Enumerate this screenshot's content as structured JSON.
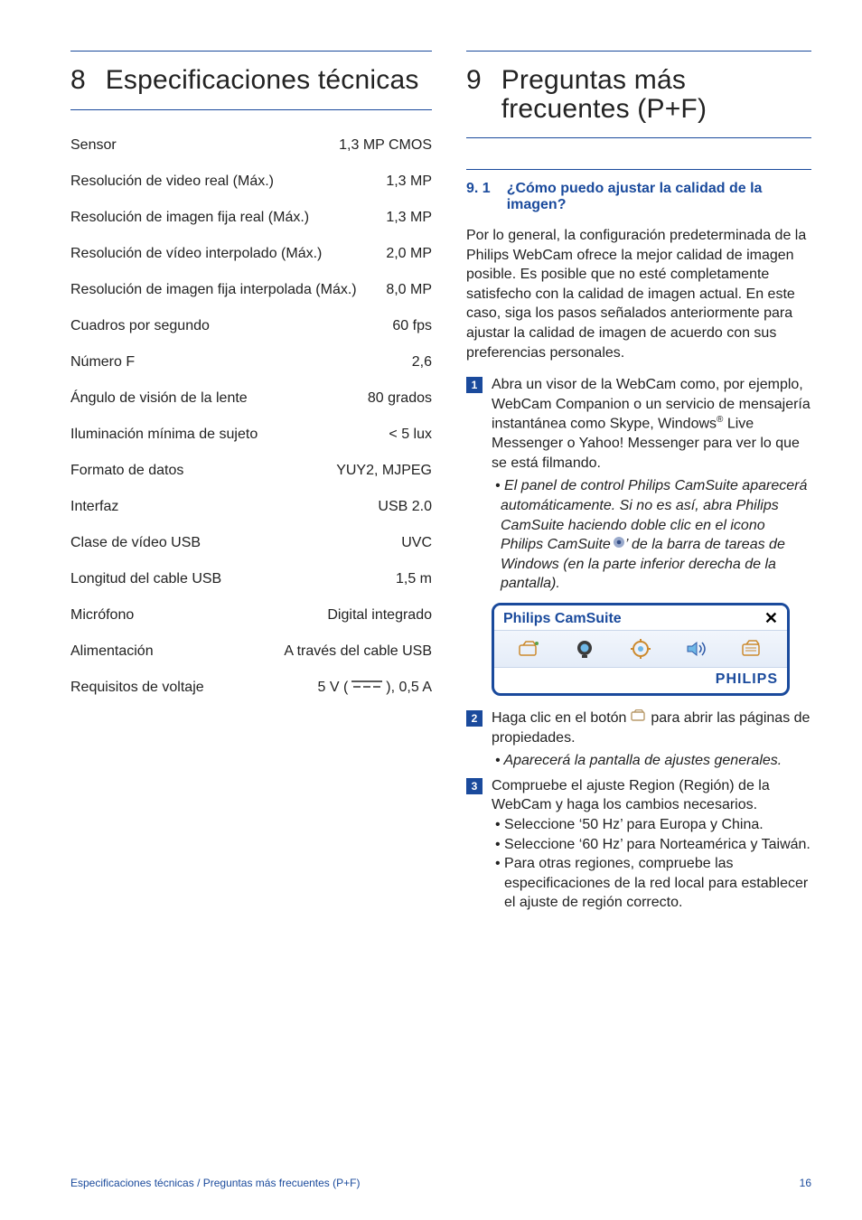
{
  "left": {
    "section_number": "8",
    "section_title": "Especificaciones técnicas",
    "specs": [
      {
        "label": "Sensor",
        "value": "1,3 MP CMOS"
      },
      {
        "label": "Resolución de video real (Máx.)",
        "value": "1,3 MP"
      },
      {
        "label": "Resolución de imagen fija real (Máx.)",
        "value": "1,3 MP"
      },
      {
        "label": "Resolución de vídeo interpolado (Máx.)",
        "value": "2,0 MP"
      },
      {
        "label": "Resolución de imagen fija interpolada (Máx.)",
        "value": "8,0 MP"
      },
      {
        "label": "Cuadros por segundo",
        "value": "60 fps"
      },
      {
        "label": "Número F",
        "value": "2,6"
      },
      {
        "label": "Ángulo de visión de la lente",
        "value": "80 grados"
      },
      {
        "label": "Iluminación mínima de sujeto",
        "value": "< 5 lux"
      },
      {
        "label": "Formato de datos",
        "value": "YUY2, MJPEG"
      },
      {
        "label": "Interfaz",
        "value": "USB 2.0"
      },
      {
        "label": "Clase de vídeo USB",
        "value": "UVC"
      },
      {
        "label": "Longitud del cable USB",
        "value": "1,5 m"
      },
      {
        "label": "Micrófono",
        "value": "Digital integrado"
      },
      {
        "label": "Alimentación",
        "value": "A través del cable USB"
      }
    ],
    "voltage_label": "Requisitos de voltaje",
    "voltage_pre": "5 V (",
    "voltage_post": "), 0,5 A"
  },
  "right": {
    "section_number": "9",
    "section_title": "Preguntas más frecuentes (P+F)",
    "sub_number": "9. 1",
    "sub_title": "¿Cómo puedo ajustar la calidad de la imagen?",
    "intro": "Por lo general, la configuración predeterminada de la Philips WebCam ofrece la mejor calidad de imagen posible. Es posible que no esté completamente satisfecho con la calidad de imagen actual. En este caso, siga los pasos señalados anteriormente para ajustar la calidad de imagen de acuerdo con sus preferencias personales.",
    "step1_a": "Abra un visor de la WebCam como, por ejemplo, WebCam Companion o un servicio de mensajería instantánea como Skype, Windows",
    "step1_sup": "®",
    "step1_b": " Live Messenger o Yahoo! Messenger para ver lo que se está filmando.",
    "step1_note_a": "• El panel de control Philips CamSuite aparecerá automáticamente. Si no es así, abra Philips CamSuite haciendo doble clic en el icono Philips CamSuite ‘",
    "step1_note_b": "’ de la barra de tareas de Windows (en la parte inferior derecha de la pantalla).",
    "camsuite_title": "Philips CamSuite",
    "camsuite_close": "✕",
    "camsuite_brand": "PHILIPS",
    "step2_a": "Haga clic en el botón ",
    "step2_b": " para abrir las páginas de propiedades.",
    "step2_note": "• Aparecerá la pantalla de ajustes generales.",
    "step3": "Compruebe el ajuste Region (Región) de la WebCam y haga los cambios necesarios.",
    "step3_b1": "• Seleccione ‘50 Hz’ para Europa y China.",
    "step3_b2": "• Seleccione ‘60 Hz’ para Norteamérica y Taiwán.",
    "step3_b3": "• Para otras regiones, compruebe las especificaciones de la red local para establecer el ajuste de región correcto."
  },
  "footer": {
    "left": "Especificaciones técnicas / Preguntas más frecuentes (P+F)",
    "right": "16"
  }
}
